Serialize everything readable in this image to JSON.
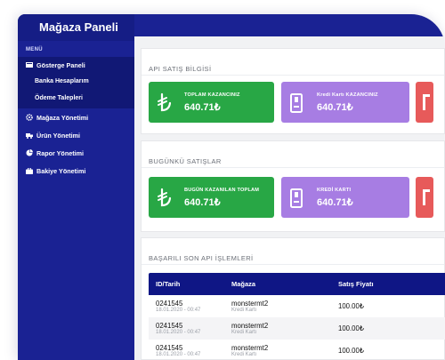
{
  "sidebar": {
    "title": "Mağaza Paneli",
    "menu_heading": "MENÜ",
    "items": [
      {
        "label": "Gösterge Paneli",
        "icon": "dashboard-icon",
        "active": true
      },
      {
        "label": "Banka Hesaplarım",
        "sub": true
      },
      {
        "label": "Ödeme Talepleri",
        "sub": true
      },
      {
        "label": "Mağaza Yönetimi",
        "icon": "gear-icon"
      },
      {
        "label": "Ürün Yönetimi",
        "icon": "truck-icon"
      },
      {
        "label": "Rapor Yönetimi",
        "icon": "pie-chart-icon"
      },
      {
        "label": "Bakiye Yönetimi",
        "icon": "briefcase-icon"
      }
    ]
  },
  "api_sales": {
    "title": "API SATIŞ BİLGİSİ",
    "tiles": [
      {
        "label": "TOPLAM KAZANCINIZ",
        "value": "640.71₺",
        "icon": "lira-icon",
        "color": "#28a745"
      },
      {
        "label": "Kredi Kartı KAZANCINIZ",
        "value": "640.71₺",
        "icon": "credit-card-icon",
        "color": "#a77de3"
      },
      {
        "label": "",
        "value": "",
        "icon": "",
        "color": "#e75a5a"
      }
    ]
  },
  "today_sales": {
    "title": "BUGÜNKÜ SATIŞLAR",
    "tiles": [
      {
        "label": "BUGÜN KAZANILAN TOPLAM",
        "value": "640.71₺",
        "icon": "lira-icon",
        "color": "#28a745"
      },
      {
        "label": "KREDİ KARTI",
        "value": "640.71₺",
        "icon": "credit-card-icon",
        "color": "#a77de3"
      },
      {
        "label": "",
        "value": "",
        "icon": "",
        "color": "#e75a5a"
      }
    ]
  },
  "recent": {
    "title": "BAŞARILI SON API İŞLEMLERİ",
    "columns": [
      "ID/Tarih",
      "Mağaza",
      "Satış Fiyatı"
    ],
    "rows": [
      {
        "id": "0241545",
        "date": "18.01.2020 - 00:47",
        "store": "monstermt2",
        "method": "Kredi Kartı",
        "price": "100.00₺"
      },
      {
        "id": "0241545",
        "date": "18.01.2020 - 00:47",
        "store": "monstermt2",
        "method": "Kredi Kartı",
        "price": "100.00₺"
      },
      {
        "id": "0241545",
        "date": "18.01.2020 - 00:47",
        "store": "monstermt2",
        "method": "Kredi Kartı",
        "price": "100.00₺"
      }
    ]
  }
}
